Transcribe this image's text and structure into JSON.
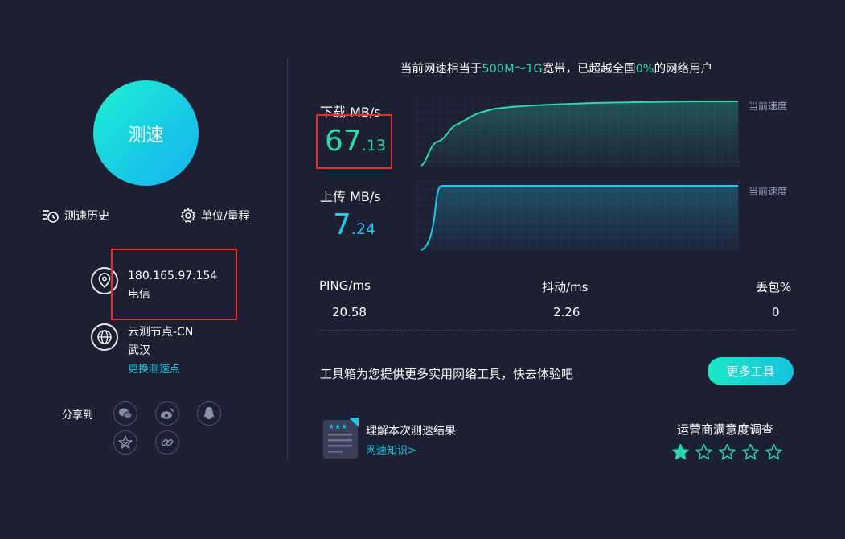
{
  "left": {
    "speed_button": "测速",
    "history_label": "测速历史",
    "units_label": "单位/量程",
    "ip": "180.165.97.154",
    "isp": "电信",
    "node_name": "云测节点-CN",
    "node_city": "武汉",
    "change_node": "更换测速点",
    "share_label": "分享到",
    "share_icons": [
      "wechat-icon",
      "weibo-icon",
      "qq-icon",
      "qzone-icon",
      "link-icon"
    ]
  },
  "headline": {
    "prefix": "当前网速相当于",
    "bandwidth": "500M～1G",
    "middle": "宽带，已超越全国",
    "percent": "0%",
    "suffix": "的网络用户"
  },
  "download": {
    "label": "下载 MB/s",
    "int": "67",
    "dec": ".13",
    "tag": "当前速度",
    "color": "#2bd8b0"
  },
  "upload": {
    "label": "上传 MB/s",
    "int": "7",
    "dec": ".24",
    "tag": "当前速度",
    "color": "#1fc6ef"
  },
  "stats": {
    "ping_label": "PING/ms",
    "ping_value": "20.58",
    "jitter_label": "抖动/ms",
    "jitter_value": "2.26",
    "loss_label": "丢包%",
    "loss_value": "0"
  },
  "tools": {
    "text": "工具箱为您提供更多实用网络工具，快去体验吧",
    "button": "更多工具"
  },
  "knowledge": {
    "title": "理解本次测速结果",
    "link": "网速知识>"
  },
  "survey": {
    "title": "运营商满意度调查",
    "rating": 1,
    "max": 5
  },
  "colors": {
    "background": "#1d2032",
    "accent_green": "#2bd8b0",
    "accent_blue": "#1fc6ef",
    "highlight_border": "#e8302b"
  }
}
